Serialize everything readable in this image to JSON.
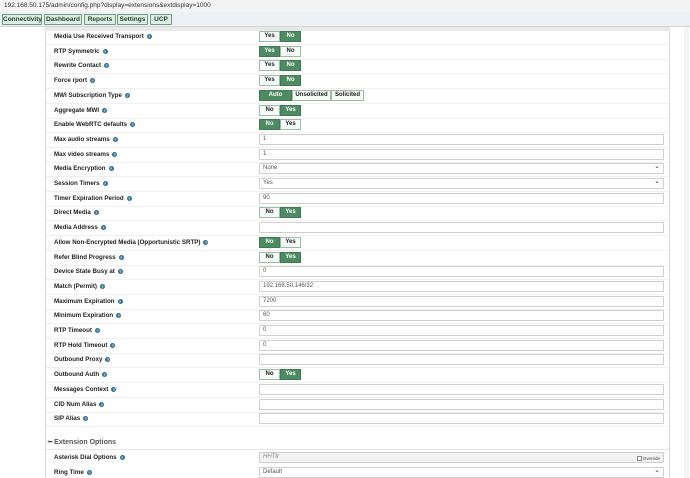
{
  "browser": {
    "url": "192.168.50.175/admin/config.php?display=extensions&extdisplay=1000"
  },
  "nav": {
    "tabs": [
      "Connectivity",
      "Dashboard",
      "Reports",
      "Settings",
      "UCP"
    ]
  },
  "rows": [
    {
      "label": "Media Use Received Transport",
      "buttons": [
        "Yes",
        "No"
      ],
      "selected": 1
    },
    {
      "label": "RTP Symmetric",
      "buttons": [
        "Yes",
        "No"
      ],
      "selected": 0
    },
    {
      "label": "Rewrite Contact",
      "buttons": [
        "Yes",
        "No"
      ],
      "selected": 1
    },
    {
      "label": "Force rport",
      "buttons": [
        "Yes",
        "No"
      ],
      "selected": 1
    },
    {
      "label": "MWI Subscription Type",
      "buttons": [
        "Auto",
        "Unsolicited",
        "Solicited"
      ],
      "selected": 0
    },
    {
      "label": "Aggregate MWI",
      "buttons": [
        "No",
        "Yes"
      ],
      "selected": 1
    },
    {
      "label": "Enable WebRTC defaults",
      "buttons": [
        "No",
        "Yes"
      ],
      "selected": 0
    },
    {
      "label": "Max audio streams",
      "value": "1"
    },
    {
      "label": "Max video streams",
      "value": "1"
    },
    {
      "label": "Media Encryption",
      "value": "None",
      "select": true
    },
    {
      "label": "Session Timers",
      "value": "Yes",
      "select": true
    },
    {
      "label": "Timer Expiration Period",
      "value": "90"
    },
    {
      "label": "Direct Media",
      "buttons": [
        "No",
        "Yes"
      ],
      "selected": 1
    },
    {
      "label": "Media Address",
      "value": ""
    },
    {
      "label": "Allow Non-Encrypted Media (Opportunistic SRTP)",
      "buttons": [
        "No",
        "Yes"
      ],
      "selected": 0
    },
    {
      "label": "Refer Blind Progress",
      "buttons": [
        "No",
        "Yes"
      ],
      "selected": 1
    },
    {
      "label": "Device State Busy at",
      "value": "0"
    },
    {
      "label": "Match (Permit)",
      "value": "192.168.50.146/32"
    },
    {
      "label": "Maximum Expiration",
      "value": "7200"
    },
    {
      "label": "Minimum Expiration",
      "value": "60"
    },
    {
      "label": "RTP Timeout",
      "value": "0"
    },
    {
      "label": "RTP Hold Timeout",
      "value": "0"
    },
    {
      "label": "Outbound Proxy",
      "value": ""
    },
    {
      "label": "Outbound Auth",
      "buttons": [
        "No",
        "Yes"
      ],
      "selected": 1
    },
    {
      "label": "Messages Context",
      "value": ""
    },
    {
      "label": "CID Num Alias",
      "value": ""
    },
    {
      "label": "SIP Alias",
      "value": ""
    }
  ],
  "section": {
    "title": "Extension Options"
  },
  "extension_rows": [
    {
      "label": "Asterisk Dial Options",
      "value": "HHTtr",
      "override_label": "Override"
    },
    {
      "label": "Ring Time",
      "value": "Default"
    }
  ],
  "colors": {
    "accent": "#4d8b62",
    "help": "#2f6f8f"
  }
}
